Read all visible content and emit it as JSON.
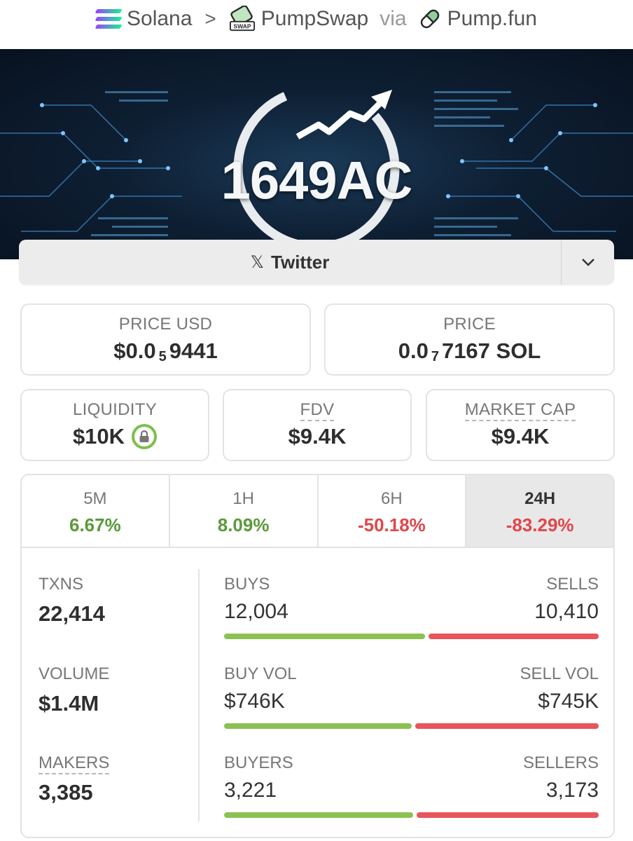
{
  "breadcrumb": {
    "chain": "Solana",
    "separator": ">",
    "dex": "PumpSwap",
    "via": "via",
    "launchpad": "Pump.fun"
  },
  "banner": {
    "title": "1649AC"
  },
  "social": {
    "twitter_label": "Twitter",
    "x_glyph": "𝕏"
  },
  "prices": {
    "usd_label": "PRICE USD",
    "usd_prefix": "$0.0",
    "usd_zeros": "5",
    "usd_digits": "9441",
    "native_label": "PRICE",
    "native_prefix": "0.0",
    "native_zeros": "7",
    "native_digits": "7167 SOL"
  },
  "metrics": {
    "liquidity_label": "LIQUIDITY",
    "liquidity_value": "$10K",
    "fdv_label": "FDV",
    "fdv_value": "$9.4K",
    "mcap_label": "MARKET CAP",
    "mcap_value": "$9.4K"
  },
  "timeframes": [
    {
      "label": "5M",
      "change": "6.67%",
      "direction": "up"
    },
    {
      "label": "1H",
      "change": "8.09%",
      "direction": "up"
    },
    {
      "label": "6H",
      "change": "-50.18%",
      "direction": "down"
    },
    {
      "label": "24H",
      "change": "-83.29%",
      "direction": "down",
      "selected": true
    }
  ],
  "stats": {
    "txns_label": "TXNS",
    "txns_value": "22,414",
    "volume_label": "VOLUME",
    "volume_value": "$1.4M",
    "makers_label": "MAKERS",
    "makers_value": "3,385",
    "buys_label": "BUYS",
    "buys_value": "12,004",
    "sells_label": "SELLS",
    "sells_value": "10,410",
    "buy_vol_label": "BUY VOL",
    "buy_vol_value": "$746K",
    "sell_vol_label": "SELL VOL",
    "sell_vol_value": "$745K",
    "buyers_label": "BUYERS",
    "buyers_value": "3,221",
    "sellers_label": "SELLERS",
    "sellers_value": "3,173",
    "buy_share_txns": 0.536,
    "buy_share_volume": 0.5,
    "buy_share_makers": 0.504
  },
  "colors": {
    "positive": "#5a9a3a",
    "negative": "#e0474c",
    "buy_bar": "#8cc152",
    "sell_bar": "#e8555a",
    "lock_ring": "#7cbf4a"
  }
}
